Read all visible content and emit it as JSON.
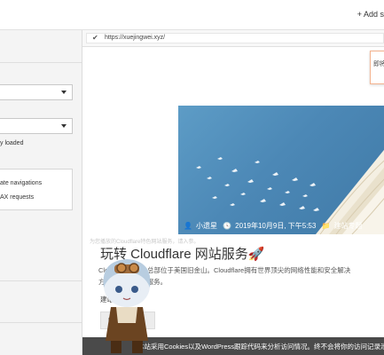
{
  "topbar": {
    "add_button": "+ Add s"
  },
  "left_panel": {
    "fragment_loaded": "y loaded",
    "option_navigations": "ate navigations",
    "option_ajax": "AX requests"
  },
  "browser": {
    "url": "https://xuejingwei.xyz/"
  },
  "search_popup": {
    "label": "即将"
  },
  "post": {
    "author": "小遗星",
    "date": "2019年10月9日, 下午5:53",
    "category": "建站专题",
    "faint_caption": "为您播放的Cloudflare特色网站服务，请入参。",
    "title": "玩转 Cloudflare 网站服务🚀",
    "desc_line1": "Clou            科技企业，总部位于美国旧金山。Cloudflare拥有世界顶尖的网络性能和安全解决",
    "desc_line2": "方                 和提高性能的服务。",
    "tags": "                  建站、建议",
    "read_more": "Rea"
  },
  "cookie_bar": {
    "text": "本站采用Cookies以及WordPress跟踪代码来分析访问情况。终不会将你的访问记录泄露"
  },
  "colors": {
    "accent_orange": "#f3b38f",
    "hero_blue": "#4c88b6",
    "cookie_bg": "#4a4a4a"
  }
}
